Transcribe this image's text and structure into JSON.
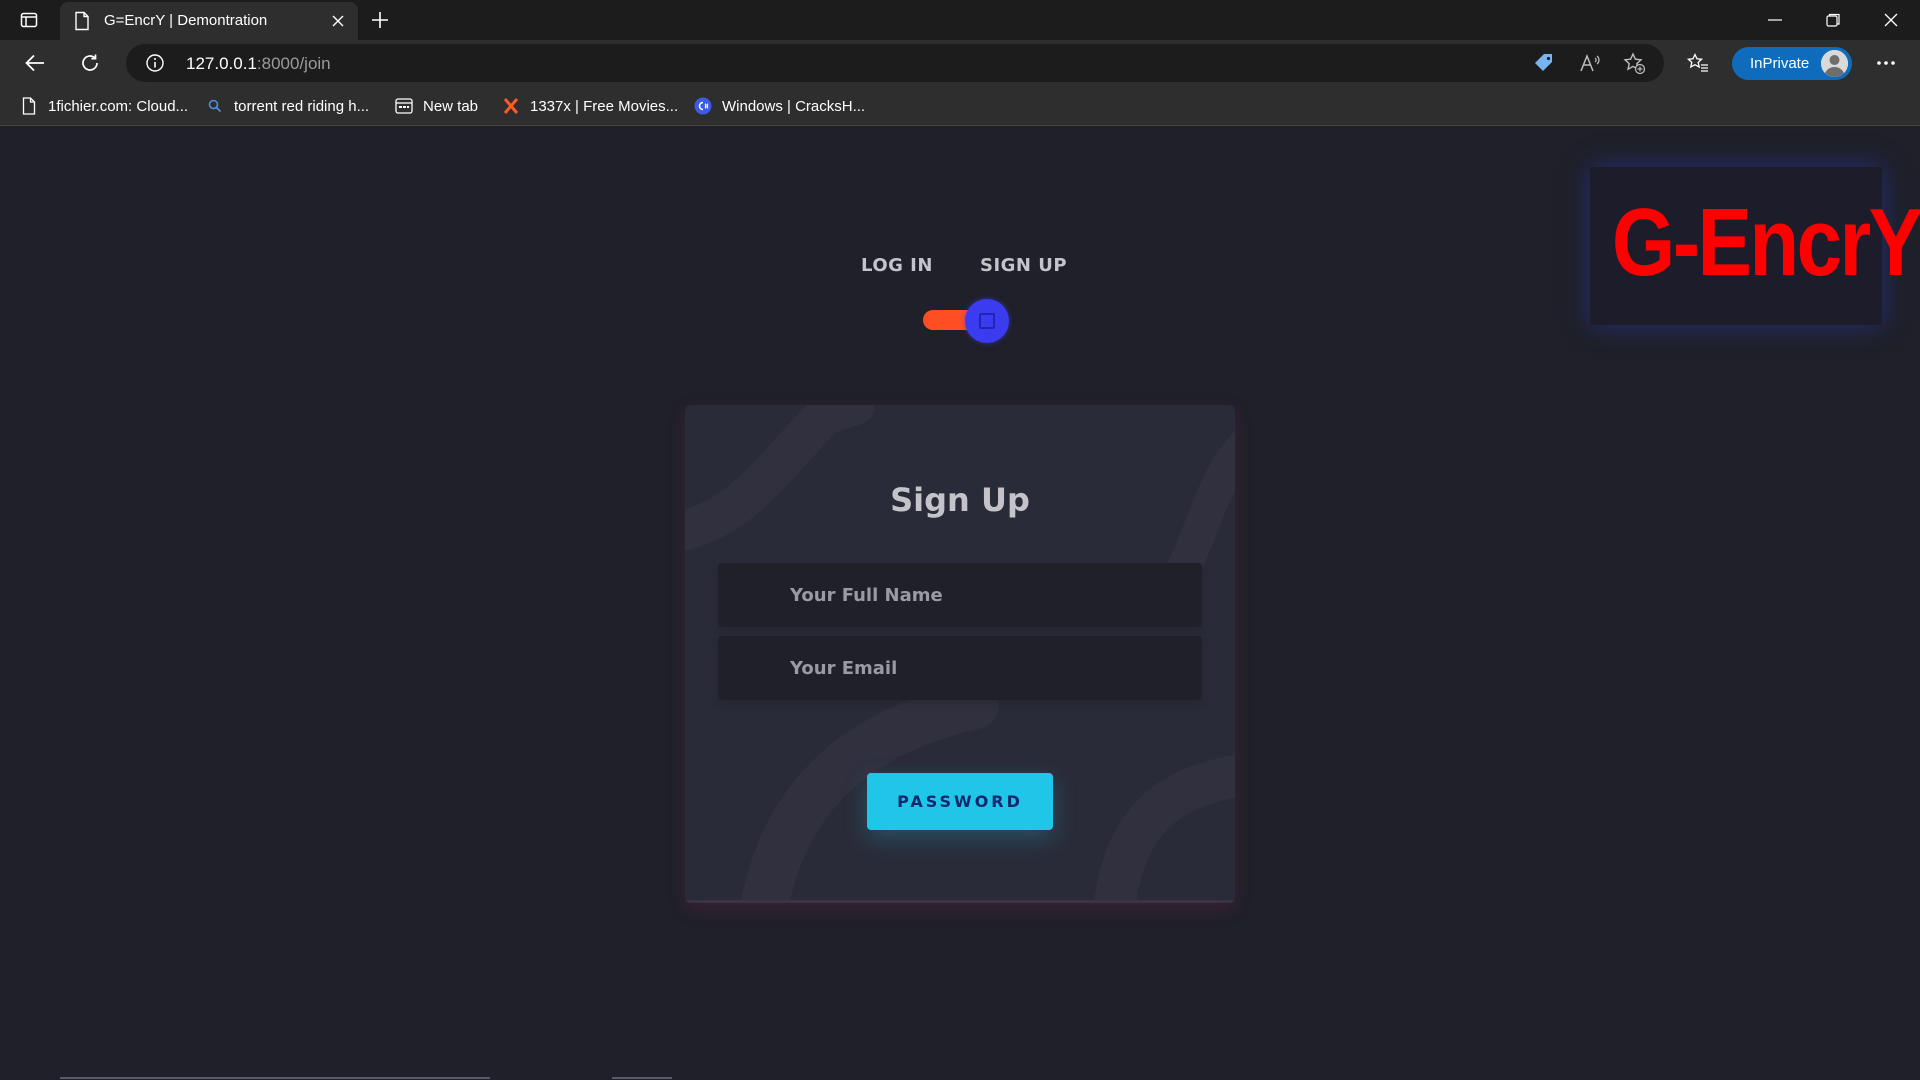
{
  "browser": {
    "tab": {
      "title": "G=EncrY | Demontration"
    },
    "address": {
      "host": "127.0.0.1",
      "path": ":8000/join"
    },
    "inprivate_label": "InPrivate",
    "bookmarks": [
      {
        "label": "1fichier.com: Cloud...",
        "icon": "page-icon"
      },
      {
        "label": "torrent red riding h...",
        "icon": "search-icon"
      },
      {
        "label": "New tab",
        "icon": "new-tab-icon"
      },
      {
        "label": "1337x | Free Movies...",
        "icon": "x-logo-icon"
      },
      {
        "label": "Windows | CracksH...",
        "icon": "csharp-logo-icon"
      }
    ]
  },
  "page": {
    "toggle": {
      "login_label": "LOG IN",
      "signup_label": "SIGN UP",
      "checked": true
    },
    "logo_text": "G-EncrY",
    "form": {
      "title": "Sign Up",
      "name_placeholder": "Your Full Name",
      "email_placeholder": "Your Email",
      "submit_label": "PASSWORD"
    }
  },
  "colors": {
    "page_bg": "#1f2029",
    "card_bg": "#2a2b38",
    "accent_orange": "#ff4e24",
    "knob_blue": "#3b3bf0",
    "button_cyan": "#1fc6e8",
    "logo_red": "#ff0000",
    "inprivate_blue": "#0f6cbd"
  }
}
